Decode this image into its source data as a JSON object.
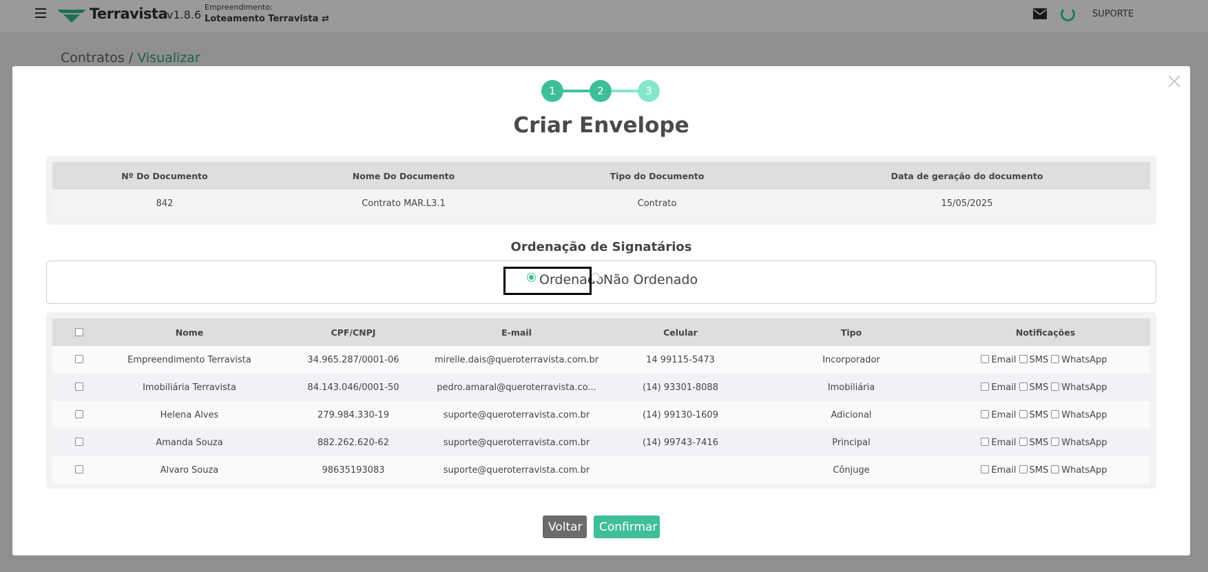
{
  "topbar": {
    "brand": "Terravista",
    "version": "v1.8.6",
    "emp_label": "Empreendimento:",
    "emp_name": "Loteamento Terravista ⇄",
    "user": "SUPORTE"
  },
  "breadcrumb": {
    "parent": "Contratos",
    "separator": "/",
    "current": "Visualizar"
  },
  "modal": {
    "steps": [
      "1",
      "2",
      "3"
    ],
    "title": "Criar Envelope",
    "document": {
      "headers": [
        "Nº Do Documento",
        "Nome Do Documento",
        "Tipo do Documento",
        "Data de geração do documento"
      ],
      "values": [
        "842",
        "Contrato MAR.L3.1",
        "Contrato",
        "15/05/2025"
      ]
    },
    "ordering": {
      "title": "Ordenação de Signatários",
      "option_ordered": "Ordenado",
      "option_unordered": "Não Ordenado",
      "selected": "Ordenado"
    },
    "signers": {
      "headers": [
        "Nome",
        "CPF/CNPJ",
        "E-mail",
        "Celular",
        "Tipo",
        "Notificações"
      ],
      "notif_labels": [
        "Email",
        "SMS",
        "WhatsApp"
      ],
      "rows": [
        {
          "nome": "Empreendimento Terravista",
          "doc": "34.965.287/0001-06",
          "email": "mirelle.dais@queroterravista.com.br",
          "celular": "14 99115-5473",
          "tipo": "Incorporador"
        },
        {
          "nome": "Imobiliária Terravista",
          "doc": "84.143.046/0001-50",
          "email": "pedro.amaral@queroterravista.co...",
          "celular": "(14) 93301-8088",
          "tipo": "Imobiliária"
        },
        {
          "nome": "Helena Alves",
          "doc": "279.984.330-19",
          "email": "suporte@queroterravista.com.br",
          "celular": "(14) 99130-1609",
          "tipo": "Adicional"
        },
        {
          "nome": "Amanda Souza",
          "doc": "882.262.620-62",
          "email": "suporte@queroterravista.com.br",
          "celular": "(14) 99743-7416",
          "tipo": "Principal"
        },
        {
          "nome": "Alvaro Souza",
          "doc": "98635193083",
          "email": "suporte@queroterravista.com.br",
          "celular": "",
          "tipo": "Cônjuge"
        }
      ]
    },
    "buttons": {
      "back": "Voltar",
      "confirm": "Confirmar"
    }
  },
  "colors": {
    "accent": "#3fbf99",
    "step_done": "#3fbf99",
    "step_pending": "#86e6cc",
    "button_back": "#6b6b6b"
  }
}
